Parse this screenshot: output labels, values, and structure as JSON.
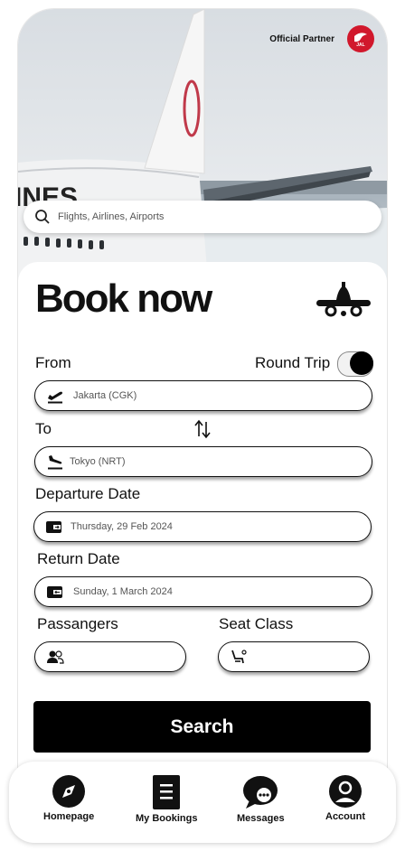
{
  "hero": {
    "partner_text": "Official Partner",
    "logo_text": "JAL",
    "search_placeholder": "Flights, Airlines, Airports"
  },
  "booking": {
    "title": "Book now",
    "from_label": "From",
    "round_trip_label": "Round Trip",
    "round_trip_enabled": true,
    "from_value": "Jakarta (CGK)",
    "to_label": "To",
    "to_value": "Tokyo (NRT)",
    "departure_label": "Departure Date",
    "departure_value": "Thursday, 29 Feb 2024",
    "return_label": "Return Date",
    "return_value": "Sunday, 1 March 2024",
    "passengers_label": "Passangers",
    "passengers_value": "",
    "seat_class_label": "Seat Class",
    "seat_class_value": "",
    "search_button": "Search"
  },
  "nav": {
    "items": [
      {
        "label": "Homepage",
        "icon": "compass-icon"
      },
      {
        "label": "My Bookings",
        "icon": "document-icon"
      },
      {
        "label": "Messages",
        "icon": "chat-icon"
      },
      {
        "label": "Account",
        "icon": "user-icon"
      }
    ]
  },
  "colors": {
    "brand_red": "#d1182c",
    "primary": "#000000"
  }
}
